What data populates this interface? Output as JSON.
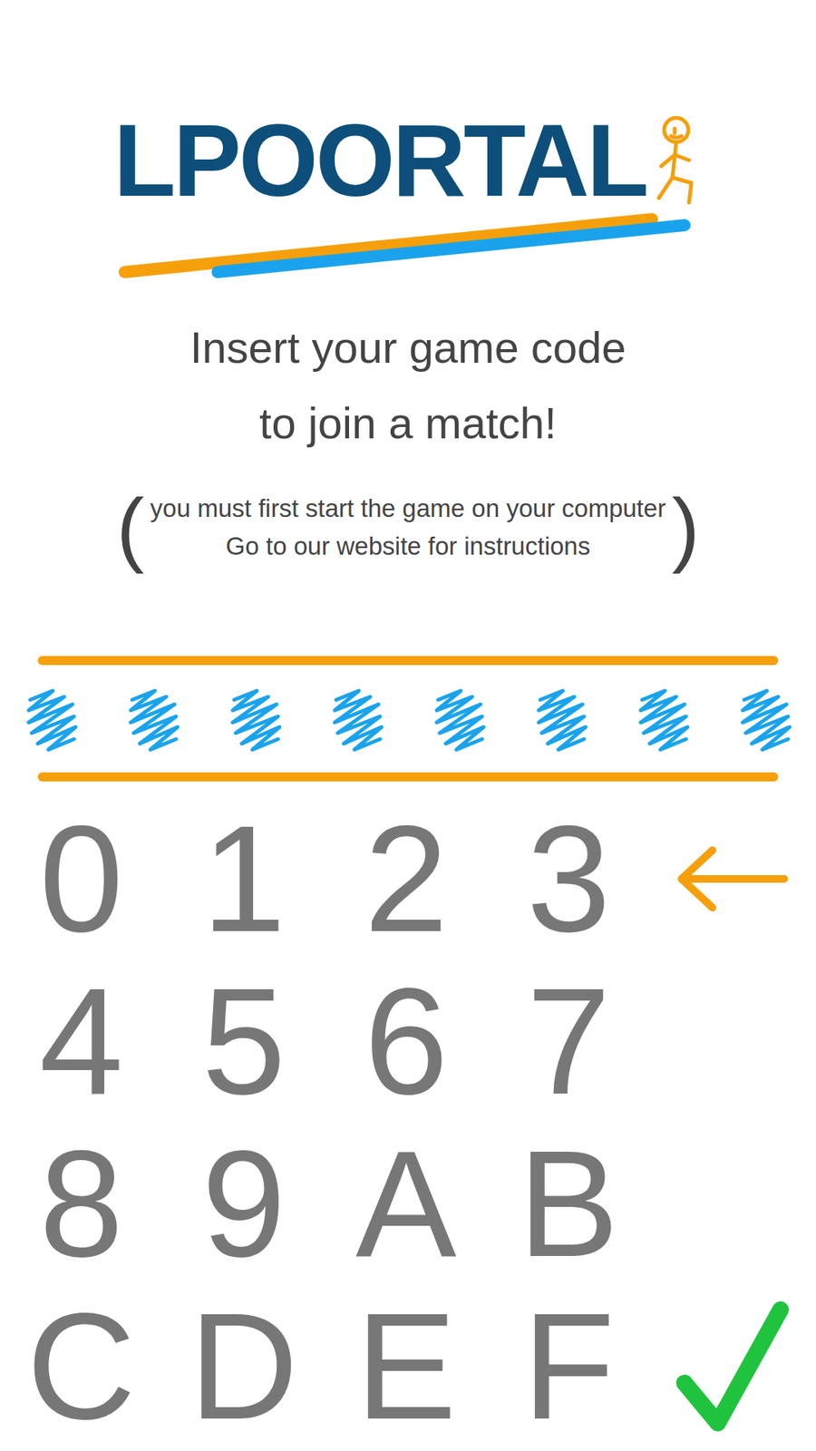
{
  "logo": {
    "text": "LPOORTAL"
  },
  "instructions": {
    "title_lines": [
      "Insert your game code",
      "to join a match!"
    ],
    "note_brackets": [
      "(",
      ")"
    ],
    "note_lines": [
      "you must first start the game on your computer",
      "Go to our website for instructions"
    ]
  },
  "code": {
    "slots": [
      {
        "filled": false
      },
      {
        "filled": false
      },
      {
        "filled": false
      },
      {
        "filled": false
      },
      {
        "filled": false
      },
      {
        "filled": false
      },
      {
        "filled": false
      },
      {
        "filled": false
      }
    ]
  },
  "keypad": {
    "keys": [
      "0",
      "1",
      "2",
      "3",
      "4",
      "5",
      "6",
      "7",
      "8",
      "9",
      "A",
      "B",
      "C",
      "D",
      "E",
      "F"
    ],
    "actions": [
      {
        "kind": "backspace"
      },
      {
        "kind": "confirm"
      }
    ]
  }
}
